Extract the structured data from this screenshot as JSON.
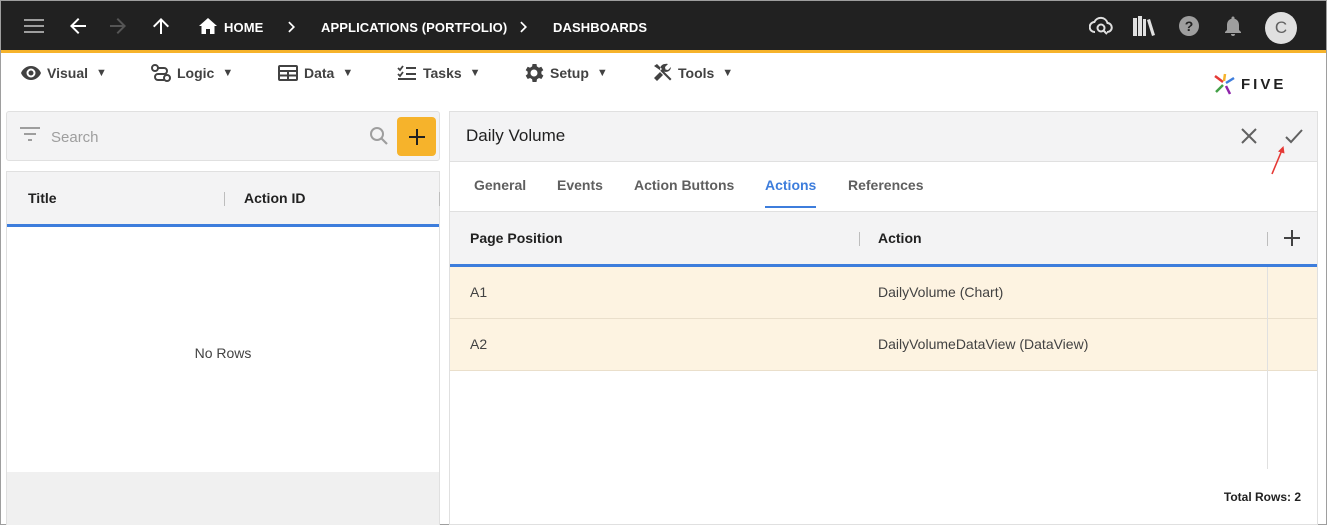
{
  "appbar": {
    "breadcrumbs": [
      "HOME",
      "APPLICATIONS (PORTFOLIO)",
      "DASHBOARDS"
    ],
    "avatar_initial": "C",
    "bg_color": "#212121",
    "accent_color": "#f6b32b"
  },
  "menubar": {
    "items": [
      {
        "label": "Visual",
        "icon": "eye-icon"
      },
      {
        "label": "Logic",
        "icon": "logic-icon"
      },
      {
        "label": "Data",
        "icon": "table-icon"
      },
      {
        "label": "Tasks",
        "icon": "tasks-icon"
      },
      {
        "label": "Setup",
        "icon": "gear-icon"
      },
      {
        "label": "Tools",
        "icon": "tools-icon"
      }
    ],
    "caret": "▼",
    "logo_text": "FIVE"
  },
  "left_panel": {
    "search_placeholder": "Search",
    "columns": [
      "Title",
      "Action ID"
    ],
    "empty_text": "No Rows"
  },
  "form": {
    "title": "Daily Volume",
    "tabs": [
      "General",
      "Events",
      "Action Buttons",
      "Actions",
      "References"
    ],
    "active_tab": "Actions",
    "grid": {
      "columns": [
        "Page Position",
        "Action"
      ],
      "rows": [
        {
          "position": "A1",
          "action": "DailyVolume (Chart)"
        },
        {
          "position": "A2",
          "action": "DailyVolumeDataView (DataView)"
        }
      ],
      "total_rows": "Total Rows: 2"
    },
    "accent_color": "#3d7ddc",
    "row_highlight": "#fdf3e1"
  }
}
